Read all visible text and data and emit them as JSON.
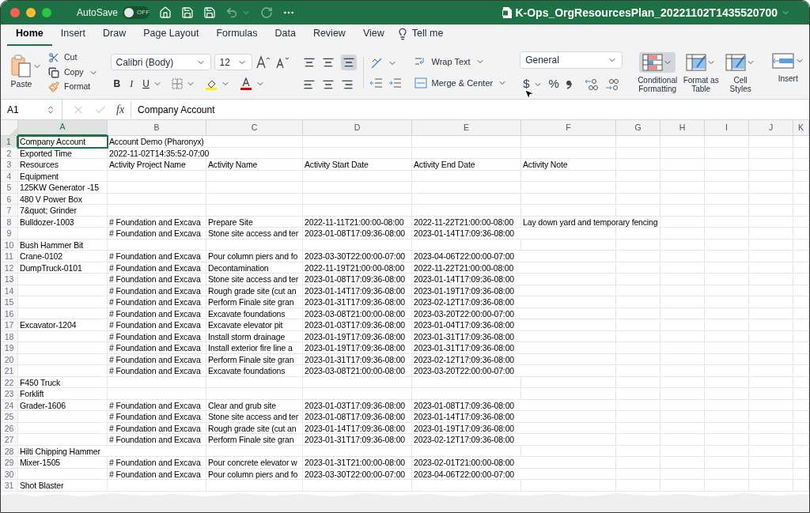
{
  "title_bar": {
    "autosave_label": "AutoSave",
    "autosave_on": false,
    "autosave_state": "OFF",
    "file_title": "K-Ops_OrgResourcesPlan_20221102T1435520700"
  },
  "tabs": [
    {
      "label": "Home",
      "selected": true
    },
    {
      "label": "Insert",
      "selected": false
    },
    {
      "label": "Draw",
      "selected": false
    },
    {
      "label": "Page Layout",
      "selected": false
    },
    {
      "label": "Formulas",
      "selected": false
    },
    {
      "label": "Data",
      "selected": false
    },
    {
      "label": "Review",
      "selected": false
    },
    {
      "label": "View",
      "selected": false
    }
  ],
  "tell_me": "Tell me",
  "ribbon": {
    "paste": "Paste",
    "cut": "Cut",
    "copy": "Copy",
    "format": "Format",
    "font_name": "Calibri (Body)",
    "font_size": "12",
    "bold": "B",
    "italic": "I",
    "underline": "U",
    "wrap_text": "Wrap Text",
    "merge_center": "Merge & Center",
    "number_format": "General",
    "currency": "$",
    "percent": "%",
    "conditional_formatting": "Conditional Formatting",
    "format_as_table": "Format as Table",
    "cell_styles": "Cell Styles",
    "insert": "Insert"
  },
  "formula_bar": {
    "name_box": "A1",
    "fx": "fx",
    "value": "Company Account"
  },
  "columns": [
    {
      "label": "A",
      "selected": true
    },
    {
      "label": "B",
      "selected": false
    },
    {
      "label": "C",
      "selected": false
    },
    {
      "label": "D",
      "selected": false
    },
    {
      "label": "E",
      "selected": false
    },
    {
      "label": "F",
      "selected": false
    },
    {
      "label": "G",
      "selected": false
    },
    {
      "label": "H",
      "selected": false
    },
    {
      "label": "I",
      "selected": false
    },
    {
      "label": "J",
      "selected": false
    },
    {
      "label": "K",
      "selected": false
    }
  ],
  "rows": [
    {
      "number": "1",
      "selected": true,
      "cells": {
        "A": "Company Account",
        "B": "Account Demo (Pharonyx)"
      }
    },
    {
      "number": "2",
      "selected": false,
      "cells": {
        "A": "Exported Time",
        "B": "2022-11-02T14:35:52-07:00"
      }
    },
    {
      "number": "3",
      "selected": false,
      "cells": {
        "A": "Resources",
        "B": "Activity Project Name",
        "C": "Activity Name",
        "D": "Activity Start Date",
        "E": "Activity End Date",
        "F": "Activity Note"
      }
    },
    {
      "number": "4",
      "selected": false,
      "cells": {
        "A": "Equipment"
      }
    },
    {
      "number": "5",
      "selected": false,
      "cells": {
        "A": "125KW Generator -15"
      }
    },
    {
      "number": "6",
      "selected": false,
      "cells": {
        "A": "480 V Power Box"
      }
    },
    {
      "number": "7",
      "selected": false,
      "cells": {
        "A": "7&quot; Grinder"
      }
    },
    {
      "number": "8",
      "selected": false,
      "cells": {
        "A": "Bulldozer-1003",
        "B": "# Foundation and Excava",
        "C": "Prepare Site",
        "D": "2022-11-11T21:00:00-08:00",
        "E": "2022-11-22T21:00:00-08:00",
        "F": "Lay down yard and temporary fencing"
      }
    },
    {
      "number": "9",
      "selected": false,
      "cells": {
        "B": "# Foundation and Excava",
        "C": "Stone site access and ter",
        "D": "2023-01-08T17:09:36-08:00",
        "E": "2023-01-14T17:09:36-08:00"
      }
    },
    {
      "number": "10",
      "selected": false,
      "cells": {
        "A": "Bush Hammer Bit"
      }
    },
    {
      "number": "11",
      "selected": false,
      "cells": {
        "A": "Crane-0102",
        "B": "# Foundation and Excava",
        "C": "Pour column piers and fo",
        "D": "2023-03-30T22:00:00-07:00",
        "E": "2023-04-06T22:00:00-07:00"
      }
    },
    {
      "number": "12",
      "selected": false,
      "cells": {
        "A": "DumpTruck-0101",
        "B": "# Foundation and Excava",
        "C": "Decontamination",
        "D": "2022-11-19T21:00:00-08:00",
        "E": "2022-11-22T21:00:00-08:00"
      }
    },
    {
      "number": "13",
      "selected": false,
      "cells": {
        "B": "# Foundation and Excava",
        "C": "Stone site access and ter",
        "D": "2023-01-08T17:09:36-08:00",
        "E": "2023-01-14T17:09:36-08:00"
      }
    },
    {
      "number": "14",
      "selected": false,
      "cells": {
        "B": "# Foundation and Excava",
        "C": "Rough grade site (cut an",
        "D": "2023-01-14T17:09:36-08:00",
        "E": "2023-01-19T17:09:36-08:00"
      }
    },
    {
      "number": "15",
      "selected": false,
      "cells": {
        "B": "# Foundation and Excava",
        "C": "Perform Finale site gran",
        "D": "2023-01-31T17:09:36-08:00",
        "E": "2023-02-12T17:09:36-08:00"
      }
    },
    {
      "number": "16",
      "selected": false,
      "cells": {
        "B": "# Foundation and Excava",
        "C": "Excavate foundations",
        "D": "2023-03-08T21:00:00-08:00",
        "E": "2023-03-20T22:00:00-07:00"
      }
    },
    {
      "number": "17",
      "selected": false,
      "cells": {
        "A": "Excavator-1204",
        "B": "# Foundation and Excava",
        "C": "Excavate elevator pit",
        "D": "2023-01-03T17:09:36-08:00",
        "E": "2023-01-04T17:09:36-08:00"
      }
    },
    {
      "number": "18",
      "selected": false,
      "cells": {
        "B": "# Foundation and Excava",
        "C": "Install storm drainage",
        "D": "2023-01-19T17:09:36-08:00",
        "E": "2023-01-31T17:09:36-08:00"
      }
    },
    {
      "number": "19",
      "selected": false,
      "cells": {
        "B": "# Foundation and Excava",
        "C": "Install exterior fire line a",
        "D": "2023-01-19T17:09:36-08:00",
        "E": "2023-01-31T17:09:36-08:00"
      }
    },
    {
      "number": "20",
      "selected": false,
      "cells": {
        "B": "# Foundation and Excava",
        "C": "Perform Finale site gran",
        "D": "2023-01-31T17:09:36-08:00",
        "E": "2023-02-12T17:09:36-08:00"
      }
    },
    {
      "number": "21",
      "selected": false,
      "cells": {
        "B": "# Foundation and Excava",
        "C": "Excavate foundations",
        "D": "2023-03-08T21:00:00-08:00",
        "E": "2023-03-20T22:00:00-07:00"
      }
    },
    {
      "number": "22",
      "selected": false,
      "cells": {
        "A": "F450 Truck"
      }
    },
    {
      "number": "23",
      "selected": false,
      "cells": {
        "A": "Forklift"
      }
    },
    {
      "number": "24",
      "selected": false,
      "cells": {
        "A": "Grader-1606",
        "B": "# Foundation and Excava",
        "C": "Clear and grub site",
        "D": "2023-01-03T17:09:36-08:00",
        "E": "2023-01-08T17:09:36-08:00"
      }
    },
    {
      "number": "25",
      "selected": false,
      "cells": {
        "B": "# Foundation and Excava",
        "C": "Stone site access and ter",
        "D": "2023-01-08T17:09:36-08:00",
        "E": "2023-01-14T17:09:36-08:00"
      }
    },
    {
      "number": "26",
      "selected": false,
      "cells": {
        "B": "# Foundation and Excava",
        "C": "Rough grade site (cut an",
        "D": "2023-01-14T17:09:36-08:00",
        "E": "2023-01-19T17:09:36-08:00"
      }
    },
    {
      "number": "27",
      "selected": false,
      "cells": {
        "B": "# Foundation and Excava",
        "C": "Perform Finale site gran",
        "D": "2023-01-31T17:09:36-08:00",
        "E": "2023-02-12T17:09:36-08:00"
      }
    },
    {
      "number": "28",
      "selected": false,
      "cells": {
        "A": "Hilti Chipping Hammer"
      }
    },
    {
      "number": "29",
      "selected": false,
      "cells": {
        "A": "Mixer-1505",
        "B": "# Foundation and Excava",
        "C": "Pour concrete elevator w",
        "D": "2023-01-31T21:00:00-08:00",
        "E": "2023-02-01T21:00:00-08:00"
      }
    },
    {
      "number": "30",
      "selected": false,
      "cells": {
        "B": "# Foundation and Excava",
        "C": "Pour column piers and fo",
        "D": "2023-03-30T22:00:00-07:00",
        "E": "2023-04-06T22:00:00-07:00"
      }
    },
    {
      "number": "31",
      "selected": false,
      "cells": {
        "A": "Shot Blaster"
      }
    }
  ]
}
